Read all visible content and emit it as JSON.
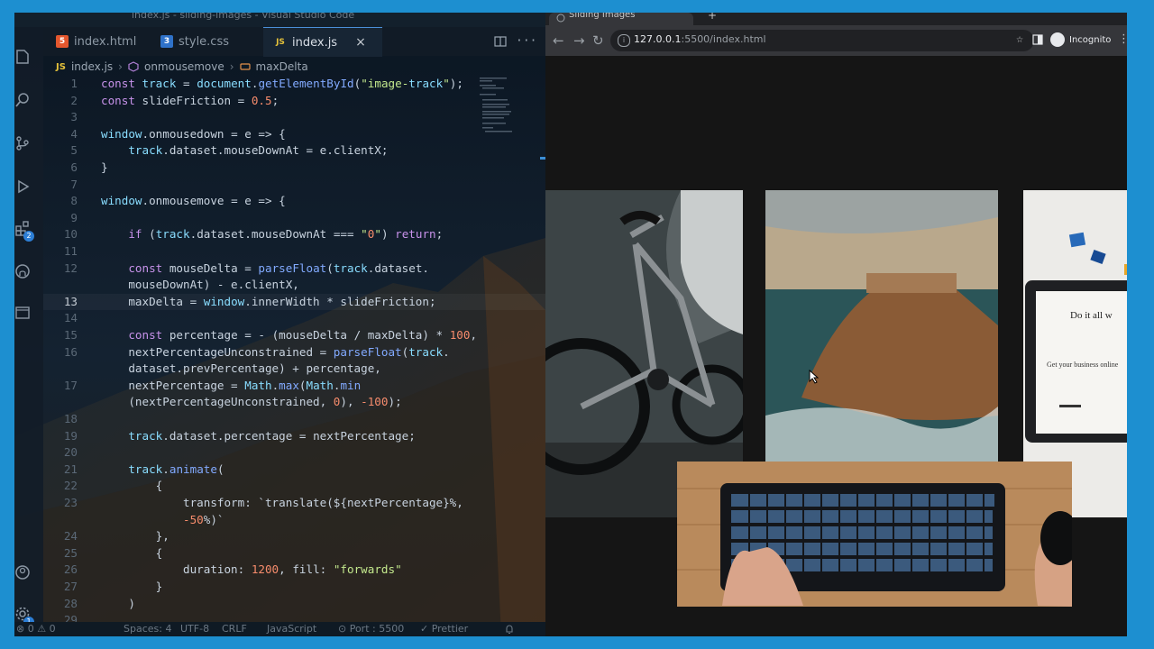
{
  "vscode": {
    "title": "index.js - sliding-images - Visual Studio Code",
    "tabs": [
      {
        "icon": "html-icon",
        "label": "index.html"
      },
      {
        "icon": "css-icon",
        "label": "style.css"
      },
      {
        "icon": "js-icon",
        "label": "index.js",
        "active": true
      }
    ],
    "tab_close": "×",
    "tab_more": "···",
    "breadcrumb": {
      "file_badge": "JS",
      "file": "index.js",
      "sep": "›",
      "symbol1": "onmousemove",
      "symbol2": "maxDelta"
    },
    "activity_badges": {
      "extensions": "2",
      "settings": "1"
    },
    "current_line": "13",
    "lines": [
      {
        "n": "1",
        "code": "const track = document.getElementById(\"image-track\");"
      },
      {
        "n": "2",
        "code": "const slideFriction = 0.5;"
      },
      {
        "n": "3",
        "code": ""
      },
      {
        "n": "4",
        "code": "window.onmousedown = e => {"
      },
      {
        "n": "5",
        "code": "    track.dataset.mouseDownAt = e.clientX;"
      },
      {
        "n": "6",
        "code": "}"
      },
      {
        "n": "7",
        "code": ""
      },
      {
        "n": "8",
        "code": "window.onmousemove = e => {"
      },
      {
        "n": "9",
        "code": ""
      },
      {
        "n": "10",
        "code": "    if (track.dataset.mouseDownAt === \"0\") return;"
      },
      {
        "n": "11",
        "code": ""
      },
      {
        "n": "12",
        "code": "    const mouseDelta = parseFloat(track.dataset."
      },
      {
        "n": "",
        "code": "    mouseDownAt) - e.clientX,"
      },
      {
        "n": "13",
        "code": "    maxDelta = window.innerWidth * slideFriction;"
      },
      {
        "n": "14",
        "code": ""
      },
      {
        "n": "15",
        "code": "    const percentage = - (mouseDelta / maxDelta) * 100,"
      },
      {
        "n": "16",
        "code": "    nextPercentageUnconstrained = parseFloat(track."
      },
      {
        "n": "",
        "code": "    dataset.prevPercentage) + percentage,"
      },
      {
        "n": "17",
        "code": "    nextPercentage = Math.max(Math.min"
      },
      {
        "n": "",
        "code": "    (nextPercentageUnconstrained, 0), -100);"
      },
      {
        "n": "18",
        "code": ""
      },
      {
        "n": "19",
        "code": "    track.dataset.percentage = nextPercentage;"
      },
      {
        "n": "20",
        "code": ""
      },
      {
        "n": "21",
        "code": "    track.animate("
      },
      {
        "n": "22",
        "code": "        {"
      },
      {
        "n": "23",
        "code": "            transform: `translate(${nextPercentage}%,"
      },
      {
        "n": "",
        "code": "            -50%)`"
      },
      {
        "n": "24",
        "code": "        },"
      },
      {
        "n": "25",
        "code": "        {"
      },
      {
        "n": "26",
        "code": "            duration: 1200, fill: \"forwards\""
      },
      {
        "n": "27",
        "code": "        }"
      },
      {
        "n": "28",
        "code": "    )"
      },
      {
        "n": "29",
        "code": ""
      }
    ],
    "status": {
      "errors": "⊗ 0 ⚠ 0",
      "spaces": "Spaces: 4",
      "encoding": "UTF-8",
      "eol": "CRLF",
      "language": "JavaScript",
      "port": "⊙ Port : 5500",
      "prettier": "✓ Prettier"
    }
  },
  "browser": {
    "tab_title": "Sliding Images",
    "url_host": "127.0.0.1",
    "url_rest": ":5500/index.html",
    "profile": "Incognito",
    "nav": {
      "back": "←",
      "forward": "→",
      "reload": "↻",
      "star": "☆",
      "menu": "⋮"
    },
    "tablet_heading": "Do it all w",
    "tablet_sub": "Get your business online"
  },
  "colors": {
    "frame": "#1d8fd0",
    "editor_bg": "#0e1620",
    "browser_bg": "#151515",
    "keyword": "#c792ea",
    "function": "#82aaff",
    "string": "#c3e88d",
    "number": "#f78c6c"
  }
}
